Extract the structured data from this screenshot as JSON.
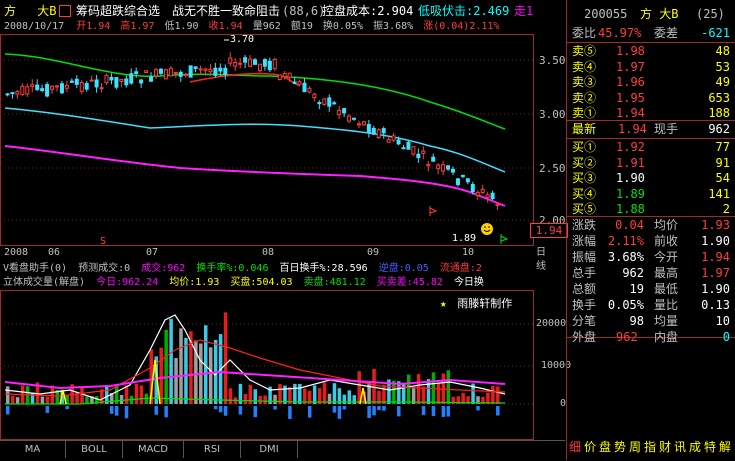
{
  "title_bar": {
    "prefix": "方",
    "stock_name": "大B",
    "indicator_label": "筹码超跌综合选",
    "strategy_text": "战无不胜一致命阻击",
    "strategy_params": "(88,6)",
    "control_cost": "控盘成本:2.904",
    "low_absorb": "低吸伏击:2.469",
    "trend_tail": "走1"
  },
  "info_bar": {
    "date": "2008/10/17",
    "open": "开1.94",
    "high": "高1.97",
    "low": "低1.90",
    "close": "收1.94",
    "volume": "量962",
    "amount": "额19",
    "turnover": "换0.05%",
    "amplitude": "振3.68%",
    "change": "涨(0.04)2.11%"
  },
  "price_axis": [
    "3.50",
    "3.00",
    "2.50",
    "2.00"
  ],
  "price_marks": {
    "peak": "3.70",
    "trough": "1.89",
    "current": "1.94"
  },
  "month_axis": [
    "2008",
    "06",
    "07",
    "08",
    "09",
    "10"
  ],
  "day_line_label": "日线",
  "volume_header": {
    "line1": {
      "title": "V看盘助手(0)",
      "forecast": "预测成交:0",
      "deal": "成交:962",
      "turnover_rate": "换手率%:0.046",
      "hundred_day": "百日换手%:28.596",
      "sentiment": "逆盘:0.05",
      "outflow": "流通盘:2"
    },
    "line2": {
      "title": "立体成交量(解盘)",
      "today": "今日:962.24",
      "avg_price": "均价:1.93",
      "buy": "买盘:504.03",
      "sell": "卖盘:481.12",
      "diff": "买卖差:45.82",
      "today_change": "今日换"
    }
  },
  "watermark": "雨滕轩制作",
  "volume_axis": [
    "20000",
    "10000",
    "0"
  ],
  "bottom_tabs": [
    "MA",
    "BOLL",
    "MACD",
    "RSI",
    "DMI"
  ],
  "side_panel": {
    "code": "200055",
    "name": "方 大B",
    "badge": "(25)",
    "ratio_label": "委比",
    "ratio_value": "45.97%",
    "diff_label": "委差",
    "diff_value": "-621",
    "sell_orders": [
      {
        "label": "卖⑤",
        "price": "1.98",
        "volume": "48"
      },
      {
        "label": "卖④",
        "price": "1.97",
        "volume": "53"
      },
      {
        "label": "卖③",
        "price": "1.96",
        "volume": "49"
      },
      {
        "label": "卖②",
        "price": "1.95",
        "volume": "653"
      },
      {
        "label": "卖①",
        "price": "1.94",
        "volume": "188"
      }
    ],
    "latest_label": "最新",
    "latest_value": "1.94",
    "hand_label": "现手",
    "hand_value": "962",
    "buy_orders": [
      {
        "label": "买①",
        "price": "1.92",
        "volume": "77"
      },
      {
        "label": "买②",
        "price": "1.91",
        "volume": "91"
      },
      {
        "label": "买③",
        "price": "1.90",
        "volume": "54"
      },
      {
        "label": "买④",
        "price": "1.89",
        "volume": "141"
      },
      {
        "label": "买⑤",
        "price": "1.88",
        "volume": "2"
      }
    ],
    "stats": [
      {
        "l1": "涨跌",
        "v1": "0.04",
        "l2": "均价",
        "v2": "1.93"
      },
      {
        "l1": "涨幅",
        "v1": "2.11%",
        "l2": "前收",
        "v2": "1.90"
      },
      {
        "l1": "振幅",
        "v1": "3.68%",
        "l2": "今开",
        "v2": "1.94"
      },
      {
        "l1": "总手",
        "v1": "962",
        "l2": "最高",
        "v2": "1.97"
      },
      {
        "l1": "总额",
        "v1": "19",
        "l2": "最低",
        "v2": "1.90"
      },
      {
        "l1": "换手",
        "v1": "0.05%",
        "l2": "量比",
        "v2": "0.13"
      },
      {
        "l1": "分笔",
        "v1": "98",
        "l2": "均量",
        "v2": "10"
      }
    ],
    "outer_label": "外盘",
    "outer_value": "962",
    "inner_label": "内盘",
    "inner_value": "0",
    "bottom_links": [
      "细",
      "价",
      "盘",
      "势",
      "周",
      "指",
      "财",
      "讯",
      "成",
      "特",
      "解"
    ]
  },
  "colors": {
    "up": "#ff3c3c",
    "down": "#00ffff",
    "ma_green": "#00e000",
    "ma_cyan": "#40e0ff",
    "ma_magenta": "#ff1fff",
    "ma_red": "#ff2020"
  }
}
